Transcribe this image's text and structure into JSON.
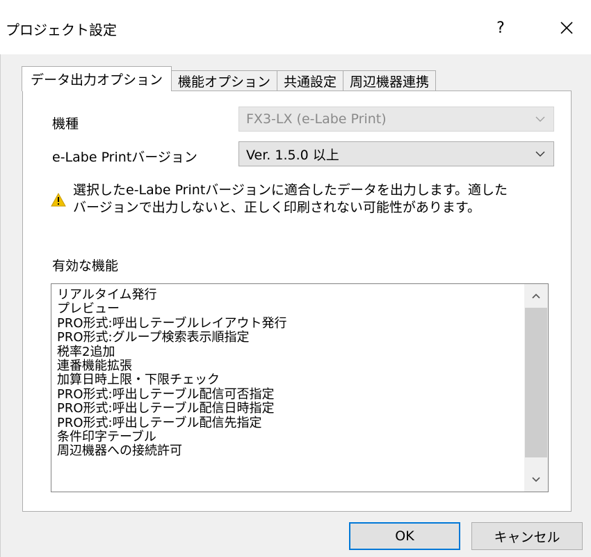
{
  "window": {
    "title": "プロジェクト設定",
    "help_label": "?",
    "close_label": "✕"
  },
  "tabs": [
    {
      "label": "データ出力オプション",
      "active": true
    },
    {
      "label": "機能オプション",
      "active": false
    },
    {
      "label": "共通設定",
      "active": false
    },
    {
      "label": "周辺機器連携",
      "active": false
    }
  ],
  "form": {
    "model_label": "機種",
    "model_value": "FX3-LX (e-Labe Print)",
    "model_disabled": true,
    "version_label": "e-Labe Printバージョン",
    "version_value": "Ver. 1.5.0 以上"
  },
  "warning": {
    "icon": "warning-icon",
    "color": "#f0c000",
    "line1": "選択したe-Labe Printバージョンに適合したデータを出力します。適した",
    "line2": "バージョンで出力しないと、正しく印刷されない可能性があります。"
  },
  "features": {
    "label": "有効な機能",
    "items": [
      "リアルタイム発行",
      "プレビュー",
      "PRO形式:呼出しテーブルレイアウト発行",
      "PRO形式:グループ検索表示順指定",
      "税率2追加",
      "連番機能拡張",
      "加算日時上限・下限チェック",
      "PRO形式:呼出しテーブル配信可否指定",
      "PRO形式:呼出しテーブル配信日時指定",
      "PRO形式:呼出しテーブル配信先指定",
      "条件印字テーブル",
      "周辺機器への接続許可"
    ]
  },
  "buttons": {
    "ok": "OK",
    "cancel": "キャンセル",
    "accent": "#0078d7"
  }
}
